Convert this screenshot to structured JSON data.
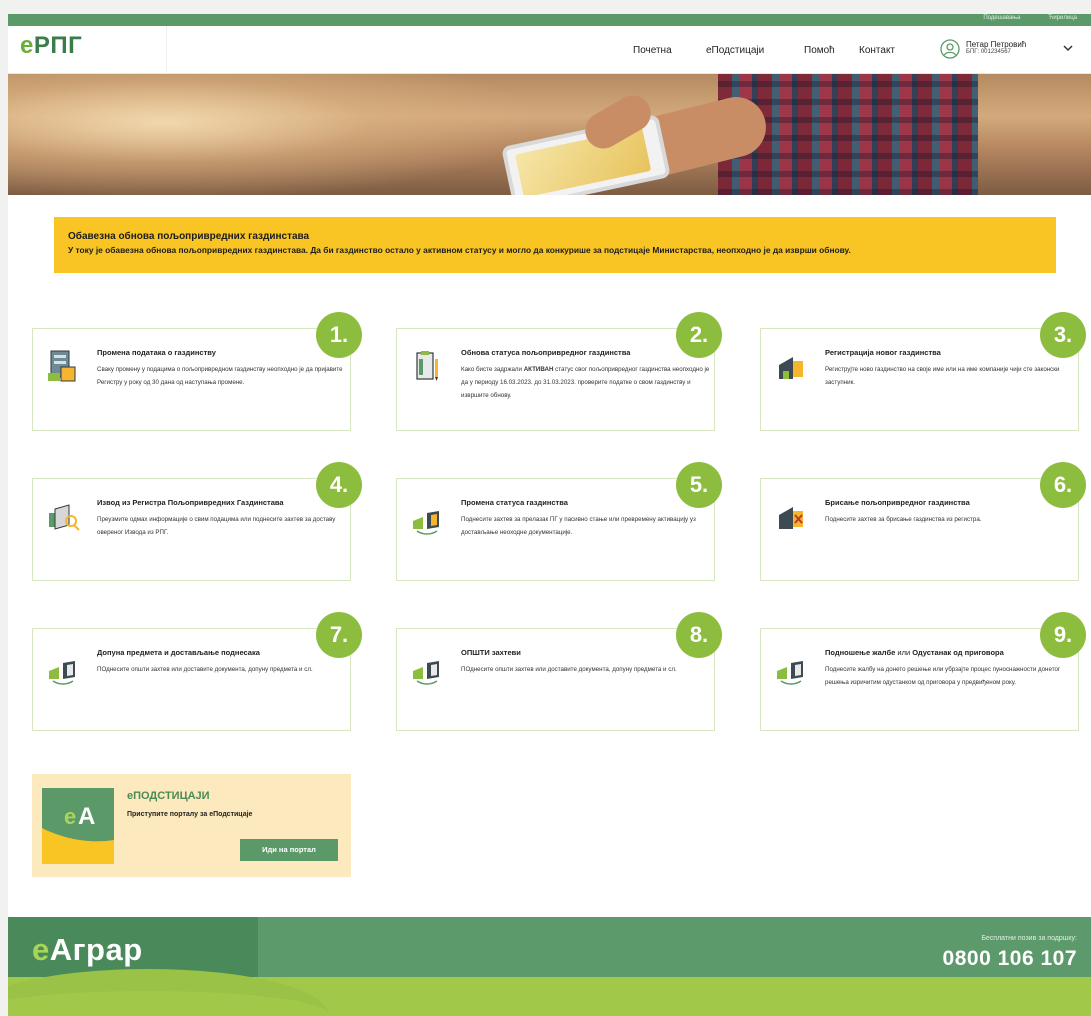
{
  "top_links": [
    "Подешавања",
    "Ћирилица"
  ],
  "header": {
    "logo": {
      "e": "е",
      "rest": "РПГ"
    },
    "nav": [
      "Почетна",
      "еПодстицаји",
      "Помоћ",
      "Контакт"
    ],
    "user": {
      "name": "Петар Петровић",
      "bpg": "БПГ: 001234567"
    }
  },
  "alert": {
    "title": "Обавезна обнова пољопривредних газдинстава",
    "text": "У току је обавезна обнова пољопривредних газдинстава. Да би газдинство остало у активном статусу и могло да конкурише за подстицаје Министарства, неопходно је да изврши обнову."
  },
  "cards": [
    {
      "badge": "1.",
      "icon": "farm-document-icon",
      "title": "Промена података о газдинству",
      "text": "Сваку промену у подацима о пољопривредном газдинству неопходно је да пријавите Регистру у року од 30 дана од наступања промене."
    },
    {
      "badge": "2.",
      "icon": "clipboard-pencil-icon",
      "title": "Обнова статуса пољопривредног газдинства",
      "text": "Како бисте задржали АКТИВАН статус свог пољопривредног газдинства неопходно је да у периоду 16.03.2023. до 31.03.2023. проверите податке о свом газдинству и извршите обнову."
    },
    {
      "badge": "3.",
      "icon": "register-farm-icon",
      "title": "Регистрација новог газдинства",
      "text": "Региструјте ново газдинство на своје име или на име компаније чији сте законски заступник."
    },
    {
      "badge": "4.",
      "icon": "register-extract-icon",
      "title": "Извод из Регистра Пољопривредних Газдинстава",
      "text": "Преузмите одмах информације о свим подацима или поднесите захтев за доставу овереног Извода из РПГ."
    },
    {
      "badge": "5.",
      "icon": "status-change-icon",
      "title": "Промена статуса газдинства",
      "text": "Поднесите захтев за прелазак ПГ у пасивно стање или превремену активацију уз достављање неоходне документације."
    },
    {
      "badge": "6.",
      "icon": "delete-farm-icon",
      "title": "Брисање пољопривредног газдинства",
      "text": "Поднесите захтев за брисање газдинства из регистра."
    },
    {
      "badge": "7.",
      "icon": "document-exchange-icon",
      "title": "Допуна предмета и достављање поднесака",
      "text": "ПОднесите општи захтев или доставите документа, допуну предмета и сл."
    },
    {
      "badge": "8.",
      "icon": "document-exchange-icon",
      "title": "ОПШТИ захтеви",
      "text": "ПОднесите општи захтев или доставите документа, допуну предмета и сл."
    },
    {
      "badge": "9.",
      "icon": "document-exchange-icon",
      "title_bold_1": "Подношење жалбе",
      "title_or": "или",
      "title_bold_2": "Одустанак од приговора",
      "text": "Поднесите жалбу на донето решење или убрзајте процес пуноснажности донетог решења изричитим одустанком од приговора у предвиђеном року."
    }
  ],
  "promo": {
    "logo": "еА",
    "title": "еПОДСТИЦАЈИ",
    "subtitle": "Приступите порталу за еПодстицаје",
    "button": "Иди на портал"
  },
  "footer": {
    "logo": {
      "e": "е",
      "rest": "Аграр"
    },
    "phone_label": "Бесплатни позив за подршку:",
    "phone": "0800 106 107"
  },
  "colors": {
    "green": "#5b9a68",
    "light_green": "#8dbd3e",
    "alert": "#f9c524",
    "promo_bg": "#fde9be"
  }
}
